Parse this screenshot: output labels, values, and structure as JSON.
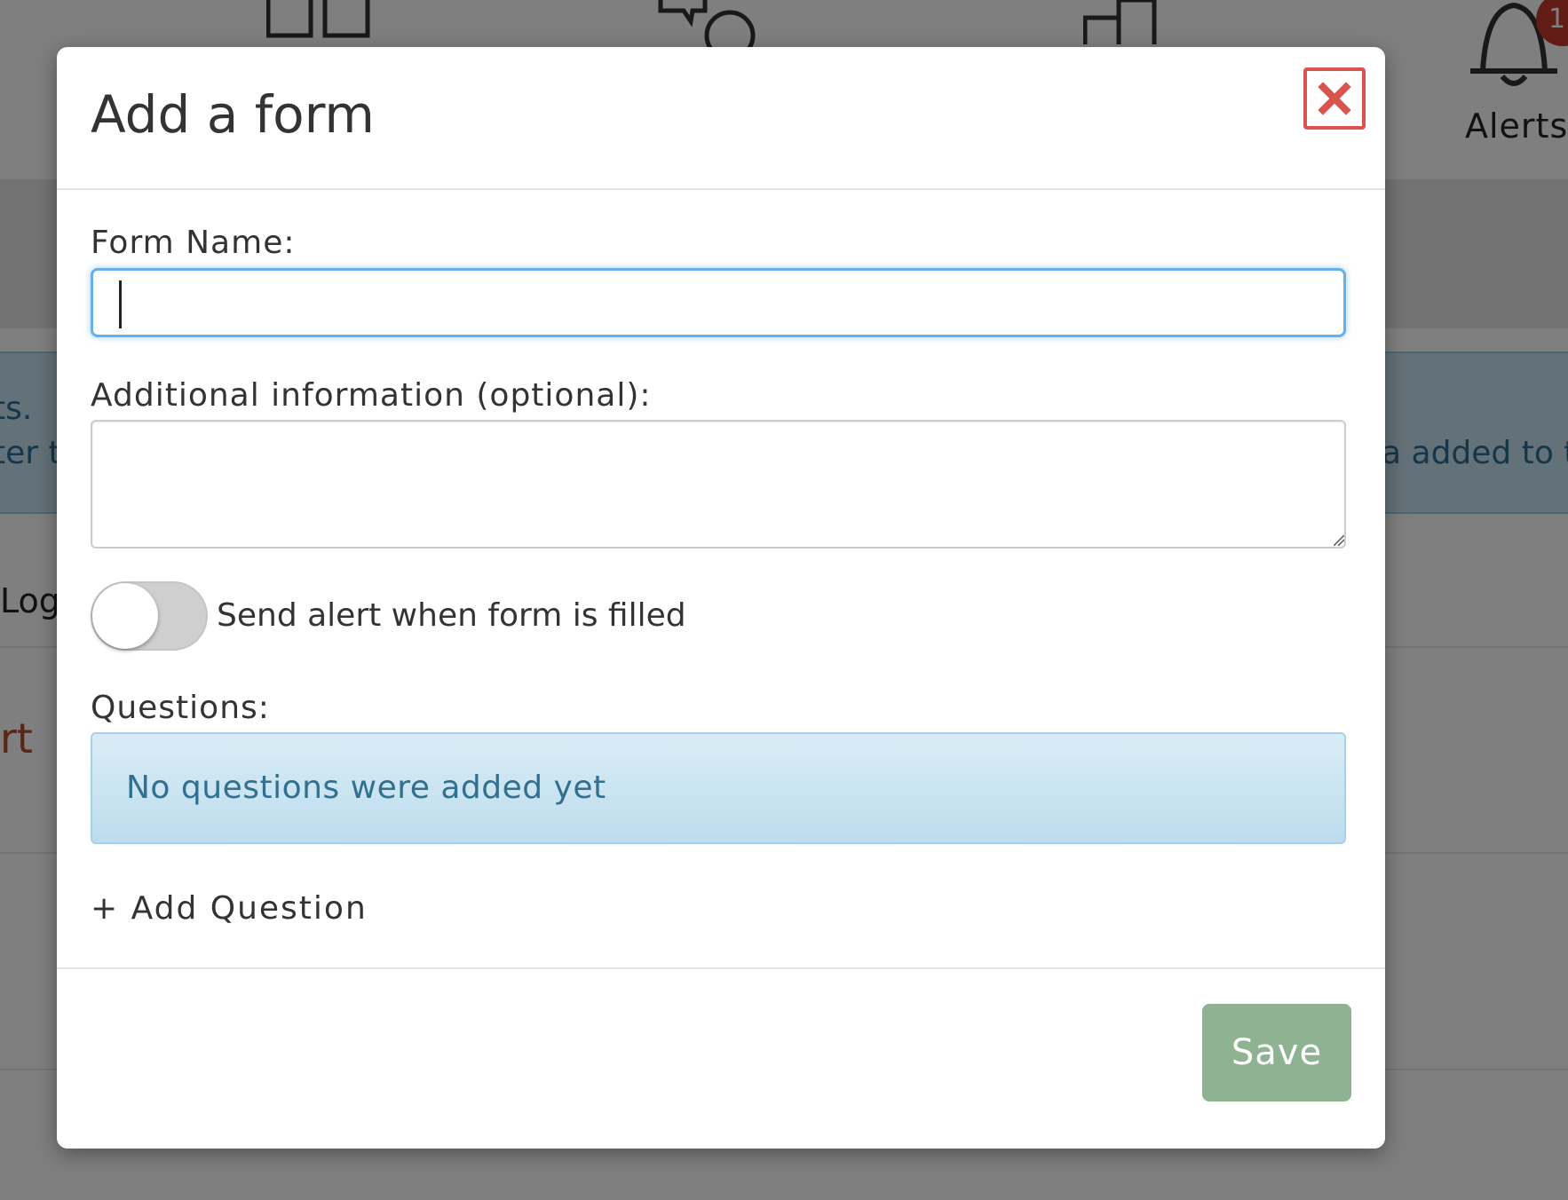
{
  "background": {
    "info_fragment_1": "ts.",
    "info_fragment_2": "ter t",
    "info_fragment_3": "a added to t",
    "log_fragment": "Log",
    "red_fragment": "rt",
    "alerts_label": "Alerts",
    "alerts_badge": "1",
    "nav_icons": [
      "layout-icon",
      "chat-bug-icon",
      "chart-icon",
      "bell-icon"
    ]
  },
  "modal": {
    "title": "Add a form",
    "close_icon": "close-icon",
    "form_name_label": "Form Name:",
    "form_name_value": "",
    "form_name_placeholder": "",
    "additional_info_label": "Additional information (optional):",
    "additional_info_value": "",
    "alert_toggle": {
      "label": "Send alert when form is filled",
      "enabled": false
    },
    "questions_label": "Questions:",
    "questions_empty_message": "No questions were added yet",
    "add_question_label": "+ Add Question",
    "save_label": "Save"
  },
  "colors": {
    "close_red": "#d9534f",
    "focus_blue": "#66afe9",
    "info_text": "#31708f",
    "save_green": "#8fb392"
  }
}
